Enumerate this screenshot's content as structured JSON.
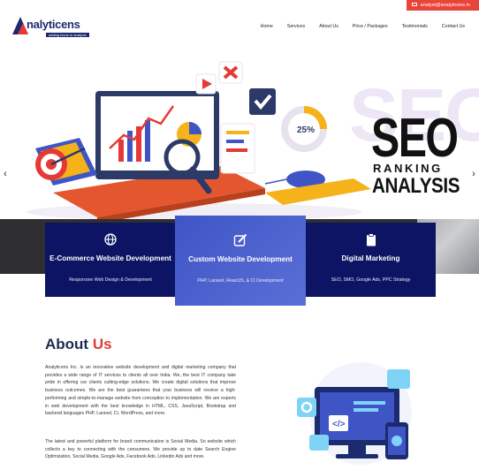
{
  "topbar": {
    "email": "analyst@analyticens.in"
  },
  "brand": {
    "logo_main": "nalyticens",
    "logo_tagline": "adding focus to analysis"
  },
  "nav": {
    "items": [
      "Home",
      "Services",
      "About Us",
      "Price / Packages",
      "Testimonials",
      "Contact Us"
    ]
  },
  "hero": {
    "seo_title": "SEO",
    "seo_line1": "RANKING",
    "seo_line2": "ANALYSIS",
    "prev_arrow": "‹",
    "next_arrow": "›",
    "chart_badge": "25%"
  },
  "services": [
    {
      "title": "E-Commerce Website Development",
      "subtitle": "Responsive Web Design & Development",
      "icon": "globe-icon"
    },
    {
      "title": "Custom Website Development",
      "subtitle": "PHP, Laravel, ReactJS, & CI Development",
      "icon": "edit-icon"
    },
    {
      "title": "Digital Marketing",
      "subtitle": "SEO, SMO, Google Ads, PPC Strategy",
      "icon": "clipboard-icon"
    }
  ],
  "about": {
    "title_main": "About",
    "title_accent": "Us",
    "para1": "Analyticens Inc. is an innovative website development and digital marketing company that provides a wide range of IT services to clients all over India. We, the best IT company take pride in offering our clients cutting-edge solutions. We create digital solutions that improve business outcomes. We are the best guarantees that your business will receive a high-performing and simple-to-manage website from conception to implementation. We are experts in web development with the best knowledge in HTML, CSS, JavaScript, Bootstrap and backend languages PHP, Laravel, CI, WordPress, and more.",
    "para2": "The latest and powerful platform for brand communication is Social Media. So website which collects a key to connecting with the consumers. We provide up to date Search Engine Optimization, Social Media, Google Ads, Facebook Ads, Linkedin Ads and more."
  },
  "colors": {
    "accent": "#e53935",
    "navy": "#0c1463",
    "brand": "#1c2b6e",
    "card_highlight": "#4a5fd0"
  }
}
